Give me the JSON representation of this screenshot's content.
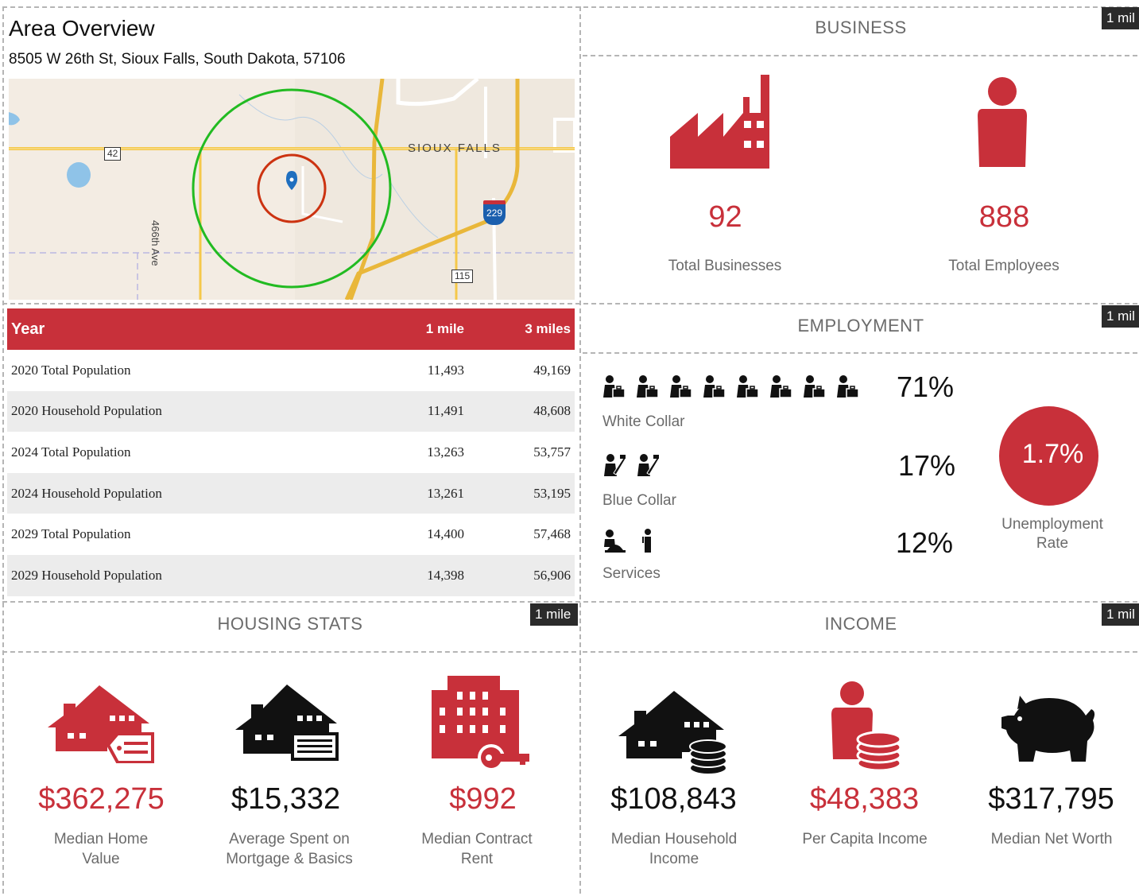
{
  "overview": {
    "title": "Area Overview",
    "address": "8505 W 26th St, Sioux Falls, South Dakota, 57106",
    "map": {
      "city_label": "SIOUX FALLS",
      "road_label": "466th Ave",
      "route_42": "42",
      "route_115": "115",
      "interstate_229": "229"
    }
  },
  "population_table": {
    "headers": [
      "Year",
      "1 mile",
      "3 miles"
    ],
    "rows": [
      [
        "2020 Total Population",
        "11,493",
        "49,169"
      ],
      [
        "2020 Household Population",
        "11,491",
        "48,608"
      ],
      [
        "2024 Total Population",
        "13,263",
        "53,757"
      ],
      [
        "2024 Household Population",
        "13,261",
        "53,195"
      ],
      [
        "2029 Total Population",
        "14,400",
        "57,468"
      ],
      [
        "2029 Household Population",
        "14,398",
        "56,906"
      ]
    ]
  },
  "business": {
    "title": "BUSINESS",
    "radius_tag": "1 mil",
    "total_businesses": "92",
    "total_businesses_label": "Total Businesses",
    "total_employees": "888",
    "total_employees_label": "Total Employees"
  },
  "employment": {
    "title": "EMPLOYMENT",
    "radius_tag": "1 mil",
    "white_collar_pct": "71%",
    "white_collar_label": "White Collar",
    "white_collar_icons": 8,
    "blue_collar_pct": "17%",
    "blue_collar_label": "Blue Collar",
    "blue_collar_icons": 2,
    "services_pct": "12%",
    "services_label": "Services",
    "services_icons": 2,
    "unemployment_rate": "1.7%",
    "unemployment_label_1": "Unemployment",
    "unemployment_label_2": "Rate"
  },
  "housing": {
    "title": "HOUSING STATS",
    "radius_tag": "1 mile",
    "median_home_value": "$362,275",
    "median_home_value_label_1": "Median Home",
    "median_home_value_label_2": "Value",
    "avg_spent": "$15,332",
    "avg_spent_label_1": "Average Spent on",
    "avg_spent_label_2": "Mortgage & Basics",
    "median_rent": "$992",
    "median_rent_label_1": "Median Contract",
    "median_rent_label_2": "Rent"
  },
  "income": {
    "title": "INCOME",
    "radius_tag": "1 mil",
    "median_household_income": "$108,843",
    "median_household_income_label_1": "Median Household",
    "median_household_income_label_2": "Income",
    "per_capita_income": "$48,383",
    "per_capita_income_label": "Per Capita Income",
    "median_net_worth": "$317,795",
    "median_net_worth_label": "Median Net Worth"
  },
  "colors": {
    "accent": "#c8303a",
    "dark": "#111111",
    "tag_bg": "#2b2b2b",
    "muted": "#6b6b6b"
  }
}
